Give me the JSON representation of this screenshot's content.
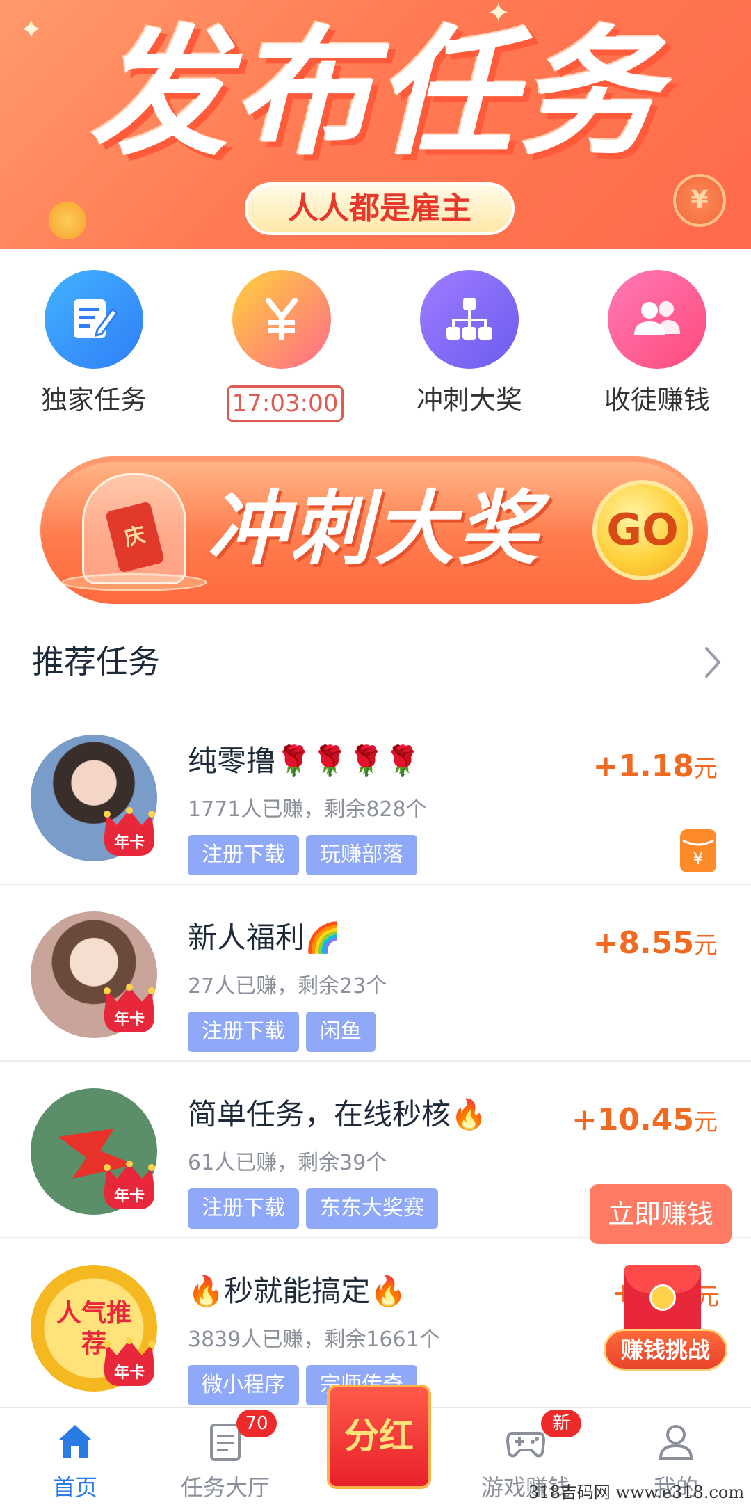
{
  "banner": {
    "title": "发布任务",
    "pill": "人人都是雇主",
    "coin_symbol": "¥"
  },
  "quick_actions": [
    {
      "label": "独家任务",
      "icon": "edit-note-icon",
      "color_from": "#43b3ff",
      "color_to": "#2f7ef7"
    },
    {
      "label": "17:03:00",
      "icon": "yuan-coin-icon",
      "color_from": "#ffd23c",
      "color_to": "#ff6a8a",
      "is_timer": true
    },
    {
      "label": "冲刺大奖",
      "icon": "hierarchy-icon",
      "color_from": "#a07cff",
      "color_to": "#6b5cf0"
    },
    {
      "label": "收徒赚钱",
      "icon": "users-icon",
      "color_from": "#ff7ab8",
      "color_to": "#ff4a7a"
    }
  ],
  "promo": {
    "jar_text": "庆",
    "text": "冲刺大奖",
    "go": "GO"
  },
  "section": {
    "title": "推荐任务"
  },
  "tasks": [
    {
      "title": "纯零撸🌹🌹🌹🌹",
      "stats": "1771人已赚，剩余828个",
      "tags": [
        "注册下载",
        "玩赚部落"
      ],
      "reward": "+1.18",
      "unit": "元",
      "badge": "年卡",
      "avatar_color": "#7a9cc8"
    },
    {
      "title": "新人福利🌈",
      "stats": "27人已赚，剩余23个",
      "tags": [
        "注册下载",
        "闲鱼"
      ],
      "reward": "+8.55",
      "unit": "元",
      "badge": "年卡",
      "avatar_color": "#c9a49a"
    },
    {
      "title": "简单任务，在线秒核🔥",
      "stats": "61人已赚，剩余39个",
      "tags": [
        "注册下载",
        "东东大奖赛"
      ],
      "reward": "+10.45",
      "unit": "元",
      "badge": "年卡",
      "avatar_color": "#5a8f6a",
      "action": "立即赚钱"
    },
    {
      "title": "🔥秒就能搞定🔥",
      "stats": "3839人已赚，剩余1661个",
      "tags": [
        "微小程序",
        "宗师传奇"
      ],
      "badge": "年卡",
      "avatar_text": "人气推荐",
      "reward_plus": "+",
      "unit": "元",
      "challenge": "赚钱挑战"
    }
  ],
  "bottom_nav": [
    {
      "label": "首页",
      "icon": "home-icon",
      "active": true
    },
    {
      "label": "任务大厅",
      "icon": "task-list-icon",
      "badge": "70"
    },
    {
      "label": "分红",
      "icon": "red-envelope-icon"
    },
    {
      "label": "游戏赚钱",
      "icon": "gamepad-icon",
      "badge": "新"
    },
    {
      "label": "我的",
      "icon": "user-icon"
    }
  ],
  "watermark": "318吉码网 www.e318.com",
  "colors": {
    "accent_orange": "#f06a22",
    "tag_blue": "#8fa8f7",
    "active_blue": "#2a7be4",
    "badge_red": "#ee2a2a"
  }
}
